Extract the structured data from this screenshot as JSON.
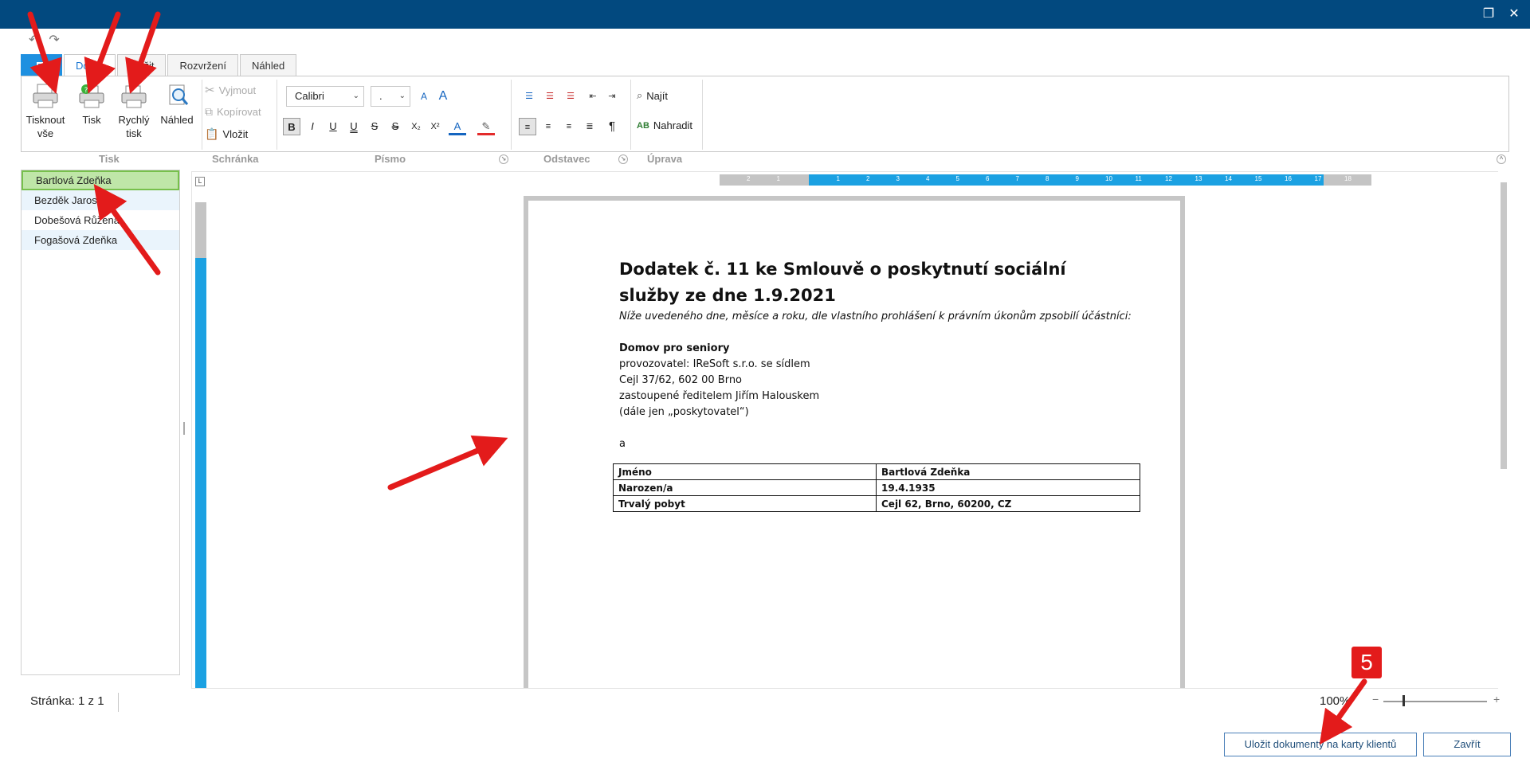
{
  "window": {
    "restore_glyph": "❐",
    "close_glyph": "✕"
  },
  "quick_access": {
    "undo_glyph": "↶",
    "redo_glyph": "↷"
  },
  "tabs": [
    {
      "label": "",
      "file": true
    },
    {
      "label": "Domů",
      "active": true
    },
    {
      "label": "Vložit"
    },
    {
      "label": "Rozvržení"
    },
    {
      "label": "Náhled"
    }
  ],
  "ribbon": {
    "print_all": "Tisknout\nvše",
    "print": "Tisk",
    "quick_print": "Rychlý\ntisk",
    "preview": "Náhled",
    "cut": "Vyjmout",
    "copy": "Kopírovat",
    "paste": "Vložit",
    "font_name": "Calibri",
    "font_size": ".",
    "find": "Najít",
    "replace": "Nahradit",
    "groups": {
      "print": "Tisk",
      "clipboard": "Schránka",
      "font": "Písmo",
      "paragraph": "Odstavec",
      "edit": "Úprava"
    },
    "format_buttons": [
      "B",
      "I",
      "U",
      "U",
      "S",
      "S",
      "X₂",
      "X²"
    ]
  },
  "clients": [
    {
      "name": "Bartlová Zdeňka",
      "selected": true
    },
    {
      "name": "Bezděk Jaroslav"
    },
    {
      "name": "Dobešová Růžena"
    },
    {
      "name": "Fogašová Zdeňka"
    }
  ],
  "document": {
    "title": "Dodatek č. 11 ke Smlouvě o poskytnutí sociální služby ze dne 1.9.2021",
    "intro": "Níže uvedeného dne, měsíce a roku, dle vlastního prohlášení k právním úkonům zpsobilí účástníci:",
    "org_name": "Domov pro seniory",
    "lines": [
      "provozovatel: IReSoft s.r.o. se sídlem",
      "Cejl 37/62, 602 00 Brno",
      "zastoupené ředitelem Jiřím Halouskem",
      "(dále jen  „poskytovatel“)"
    ],
    "conjunction": "a",
    "table": [
      [
        "Jméno",
        "Bartlová Zdeňka"
      ],
      [
        "Narozen/a",
        "19.4.1935"
      ],
      [
        "Trvalý pobyt",
        "Cejl 62, Brno, 60200, CZ"
      ]
    ]
  },
  "status": {
    "page": "Stránka: 1 z 1",
    "zoom": "100%"
  },
  "buttons": {
    "save_docs": "Uložit dokumenty na karty klientů",
    "close": "Zavřít"
  },
  "annotation_badge": "5",
  "colors": {
    "titlebar": "#02497f",
    "accent": "#1ba1e2",
    "selection": "#bfe6a8",
    "arrow": "#e31b1b"
  }
}
